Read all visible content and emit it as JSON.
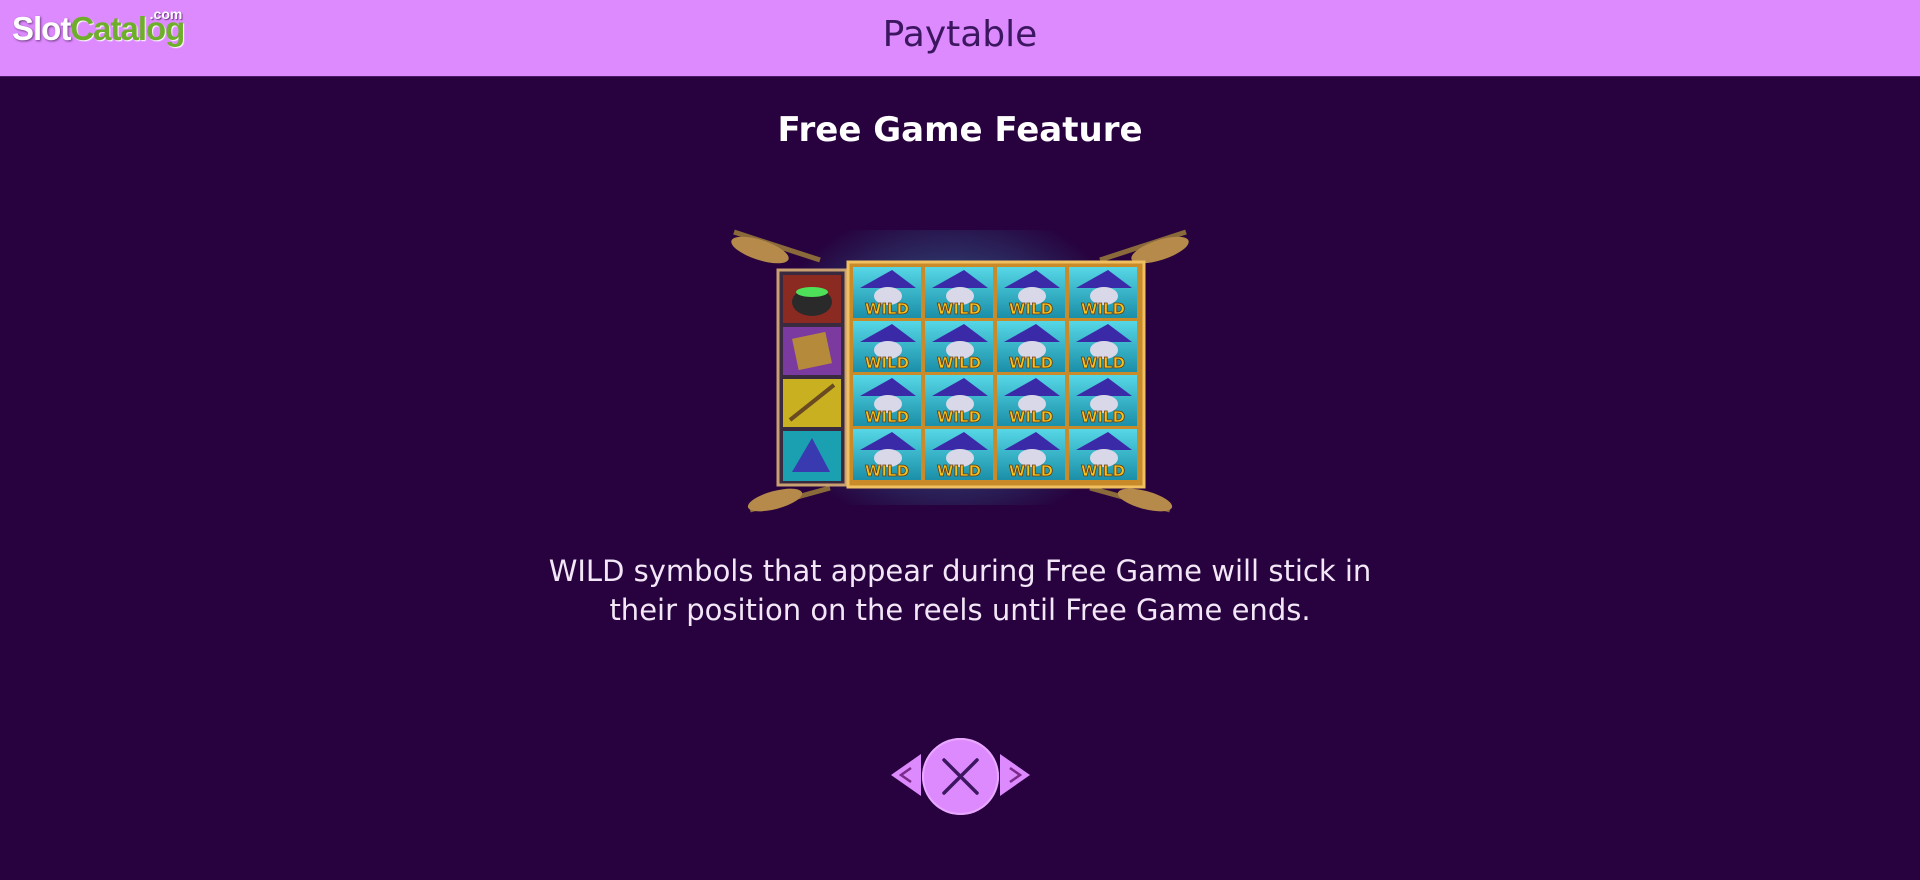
{
  "logo": {
    "part1": "Slot",
    "part2": "Catalog",
    "suffix": ".com"
  },
  "header": {
    "title": "Paytable"
  },
  "page": {
    "section_title": "Free Game Feature",
    "description_line1": "WILD symbols that appear during Free Game will stick in",
    "description_line2": "their position on the reels until Free Game ends."
  },
  "reels": {
    "wild_label": "WILD",
    "columns": 4,
    "rows": 4,
    "side_symbols": [
      "cauldron-icon",
      "spellbook-icon",
      "broom-icon",
      "witch-hat-icon"
    ]
  },
  "nav": {
    "prev_icon": "chevron-left-icon",
    "next_icon": "chevron-right-icon",
    "close_icon": "close-icon"
  },
  "colors": {
    "background": "#27023e",
    "header_bar": "#dd8aff",
    "header_text": "#3c1760",
    "accent": "#dd8aff",
    "logo_green": "#6fae2a",
    "wild_gold": "#f5c21a"
  }
}
